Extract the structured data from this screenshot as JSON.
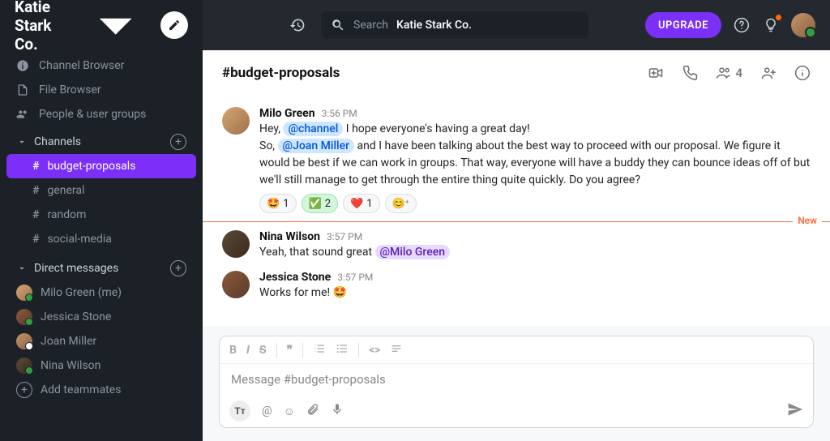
{
  "workspace": {
    "name": "Katie Stark Co."
  },
  "nav": {
    "channel_browser": "Channel Browser",
    "file_browser": "File Browser",
    "people_groups": "People & user groups"
  },
  "sections": {
    "channels_label": "Channels",
    "dms_label": "Direct messages"
  },
  "channels": [
    {
      "name": "budget-proposals",
      "active": true
    },
    {
      "name": "general",
      "active": false
    },
    {
      "name": "random",
      "active": false
    },
    {
      "name": "social-media",
      "active": false
    }
  ],
  "dms": [
    {
      "name": "Milo Green (me)",
      "status": "online"
    },
    {
      "name": "Jessica Stone",
      "status": "online"
    },
    {
      "name": "Joan Miller",
      "status": "away"
    },
    {
      "name": "Nina Wilson",
      "status": "online"
    }
  ],
  "add_teammates": "Add teammates",
  "topbar": {
    "search_prefix": "Search",
    "search_scope": "Katie Stark Co.",
    "upgrade": "UPGRADE"
  },
  "channel_header": {
    "title": "#budget-proposals",
    "member_count": "4"
  },
  "messages": [
    {
      "author": "Milo Green",
      "time": "3:56 PM",
      "lines": [
        {
          "pre": "Hey, ",
          "mention": "@channel",
          "mention_style": "blue",
          "post": "  I hope everyone's having a great day!"
        },
        {
          "pre": "So, ",
          "mention": "@Joan Miller",
          "mention_style": "blue",
          "post": "  and I have been talking about the best way to proceed with our proposal. We figure it would be best if we can work in groups. That way, everyone will have a buddy they can bounce ideas off of but  we'll still manage to get through the entire thing quite quickly. Do you agree?"
        }
      ],
      "reactions": [
        {
          "emoji": "🤩",
          "count": "1",
          "style": ""
        },
        {
          "emoji": "✅",
          "count": "2",
          "style": "green"
        },
        {
          "emoji": "❤️",
          "count": "1",
          "style": ""
        }
      ]
    },
    {
      "author": "Nina Wilson",
      "time": "3:57 PM",
      "lines": [
        {
          "pre": "Yeah, that sound great  ",
          "mention": "@Milo Green",
          "mention_style": "purple",
          "post": ""
        }
      ]
    },
    {
      "author": "Jessica Stone",
      "time": "3:57 PM",
      "lines": [
        {
          "pre": "Works for me! 🤩",
          "mention": "",
          "post": ""
        }
      ]
    }
  ],
  "divider_label": "New",
  "composer": {
    "placeholder": "Message #budget-proposals"
  }
}
